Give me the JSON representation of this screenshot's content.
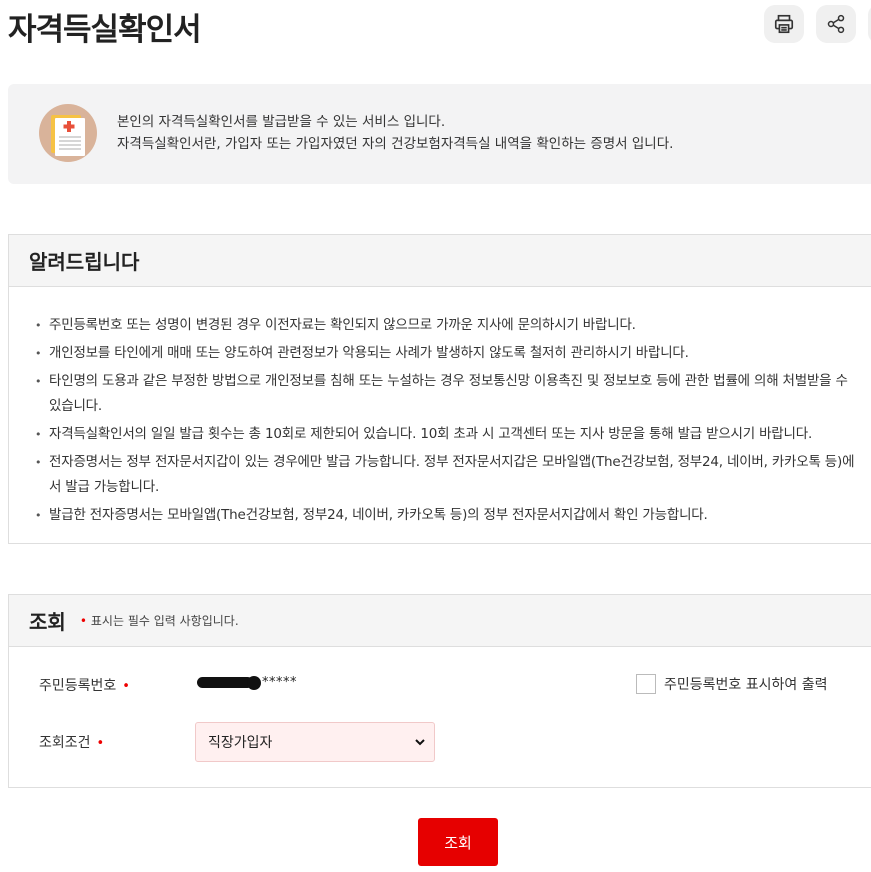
{
  "page": {
    "title": "자격득실확인서"
  },
  "toolbar": {
    "print_icon": "printer-icon",
    "share_icon": "share-icon"
  },
  "info": {
    "icon": "medical-document-icon",
    "line1": "본인의 자격득실확인서를 발급받을 수 있는 서비스 입니다.",
    "line2": "자격득실확인서란, 가입자 또는 가입자였던 자의 건강보험자격득실 내역을 확인하는 증명서 입니다."
  },
  "notice": {
    "title": "알려드립니다",
    "items": [
      "주민등록번호 또는 성명이 변경된 경우 이전자료는 확인되지 않으므로 가까운 지사에 문의하시기 바랍니다.",
      "개인정보를 타인에게 매매 또는 양도하여 관련정보가 악용되는 사례가 발생하지 않도록 철저히 관리하시기 바랍니다.",
      "타인명의 도용과 같은 부정한 방법으로 개인정보를 침해 또는 누설하는 경우 정보통신망 이용촉진 및 정보보호 등에 관한 법률에 의해 처벌받을 수 있습니다.",
      "자격득실확인서의 일일 발급 횟수는 총 10회로 제한되어 있습니다. 10회 초과 시 고객센터 또는 지사 방문을 통해 발급 받으시기 바랍니다.",
      "전자증명서는 정부 전자문서지갑이 있는 경우에만 발급 가능합니다. 정부 전자문서지갑은 모바일앱(The건강보험, 정부24, 네이버, 카카오톡 등)에서 발급 가능합니다.",
      "발급한 전자증명서는 모바일앱(The건강보험, 정부24, 네이버, 카카오톡 등)의 정부 전자문서지갑에서 확인 가능합니다."
    ]
  },
  "search": {
    "title": "조회",
    "required_marker": "•",
    "required_note": "표시는 필수 입력 사항입니다.",
    "rrn_label": "주민등록번호",
    "rrn_masked_suffix": "*****",
    "show_rrn_label": "주민등록번호 표시하여 출력",
    "show_rrn_checked": false,
    "condition_label": "조회조건",
    "condition_value": "직장가입자",
    "submit_label": "조회"
  },
  "colors": {
    "accent": "#e60000",
    "select_bg": "#fff0f0"
  }
}
